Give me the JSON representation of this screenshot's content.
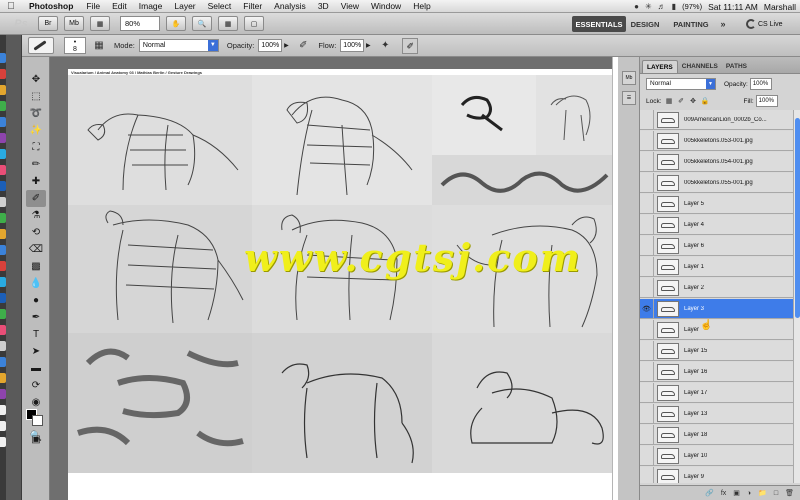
{
  "menubar": {
    "app_name": "Photoshop",
    "items": [
      "File",
      "Edit",
      "Image",
      "Layer",
      "Select",
      "Filter",
      "Analysis",
      "3D",
      "View",
      "Window",
      "Help"
    ],
    "battery": "(97%)",
    "clock": "Sat 11:11 AM",
    "user": "Marshall"
  },
  "appbar": {
    "logo": "Ps",
    "bridge_label": "Br",
    "minibridge_label": "Mb",
    "zoom": "80%",
    "workspaces": {
      "essentials": "ESSENTIALS",
      "design": "DESIGN",
      "painting": "PAINTING",
      "more": "»"
    },
    "cs_live": "CS Live"
  },
  "options": {
    "brush_size": "8",
    "mode_label": "Mode:",
    "mode_value": "Normal",
    "opacity_label": "Opacity:",
    "opacity_value": "100%",
    "flow_label": "Flow:",
    "flow_value": "100%"
  },
  "document": {
    "header": "Visualarium / Animal Anatomy 03 / Mathias Berlin / Gesture Drawings"
  },
  "watermark": "www.cgtsj.com",
  "layers_panel": {
    "tabs": [
      "LAYERS",
      "CHANNELS",
      "PATHS"
    ],
    "blend_mode": "Normal",
    "opacity_label": "Opacity:",
    "opacity_value": "100%",
    "lock_label": "Lock:",
    "fill_label": "Fill:",
    "fill_value": "100%",
    "layers": [
      {
        "name": "009AmericanLion_0002b_Co...",
        "visible": false,
        "selected": false
      },
      {
        "name": "005kkeletons.053-001.jpg",
        "visible": false,
        "selected": false
      },
      {
        "name": "005kkeletons.054-001.jpg",
        "visible": false,
        "selected": false
      },
      {
        "name": "005kkeletons.055-001.jpg",
        "visible": false,
        "selected": false
      },
      {
        "name": "Layer 5",
        "visible": false,
        "selected": false
      },
      {
        "name": "Layer 4",
        "visible": false,
        "selected": false
      },
      {
        "name": "Layer 6",
        "visible": false,
        "selected": false
      },
      {
        "name": "Layer 1",
        "visible": false,
        "selected": false
      },
      {
        "name": "Layer 2",
        "visible": false,
        "selected": false
      },
      {
        "name": "Layer 3",
        "visible": true,
        "selected": true
      },
      {
        "name": "Layer",
        "visible": false,
        "selected": false
      },
      {
        "name": "Layer 15",
        "visible": false,
        "selected": false
      },
      {
        "name": "Layer 16",
        "visible": false,
        "selected": false
      },
      {
        "name": "Layer 17",
        "visible": false,
        "selected": false
      },
      {
        "name": "Layer 13",
        "visible": false,
        "selected": false
      },
      {
        "name": "Layer 18",
        "visible": false,
        "selected": false
      },
      {
        "name": "Layer 10",
        "visible": false,
        "selected": false
      },
      {
        "name": "Layer 9",
        "visible": false,
        "selected": false
      }
    ],
    "footer_icons": [
      "link-icon",
      "fx-icon",
      "mask-icon",
      "adjustment-icon",
      "group-icon",
      "new-layer-icon",
      "trash-icon"
    ]
  },
  "colors": {
    "selection_blue": "#3e7ce9",
    "watermark_yellow": "#f0ef1b",
    "workspace_active": "#4a4a4a"
  }
}
